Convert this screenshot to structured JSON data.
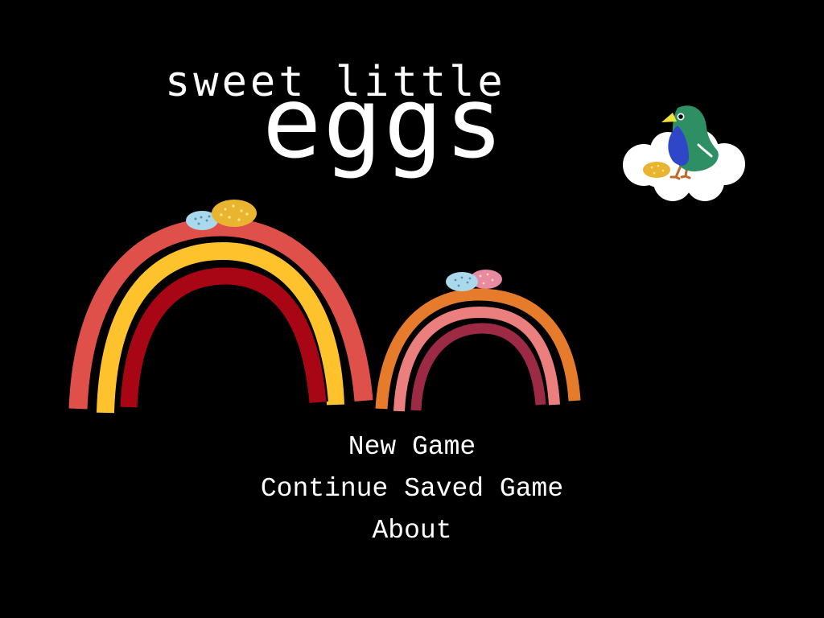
{
  "game": {
    "title_top": "sweet little",
    "title_main": "eggs"
  },
  "menu": {
    "items": [
      {
        "label": "New Game"
      },
      {
        "label": "Continue Saved Game"
      },
      {
        "label": "About"
      }
    ]
  },
  "colors": {
    "background": "#000000",
    "text": "#ffffff",
    "rainbow_large": [
      "#e0504a",
      "#fec22c",
      "#a80614"
    ],
    "rainbow_small": [
      "#e67b2c",
      "#ea7f7e",
      "#9c2a45"
    ],
    "bird_body": "#2e8f64",
    "bird_wing": "#2f46c9",
    "bird_beak": "#f0e33a",
    "egg_gold": "#e9b531",
    "egg_blue": "#a9d9ea",
    "egg_pink": "#e989a4",
    "cloud": "#ffffff"
  },
  "icons": [
    "bird-on-cloud-icon",
    "egg-icon",
    "rainbow-icon"
  ]
}
